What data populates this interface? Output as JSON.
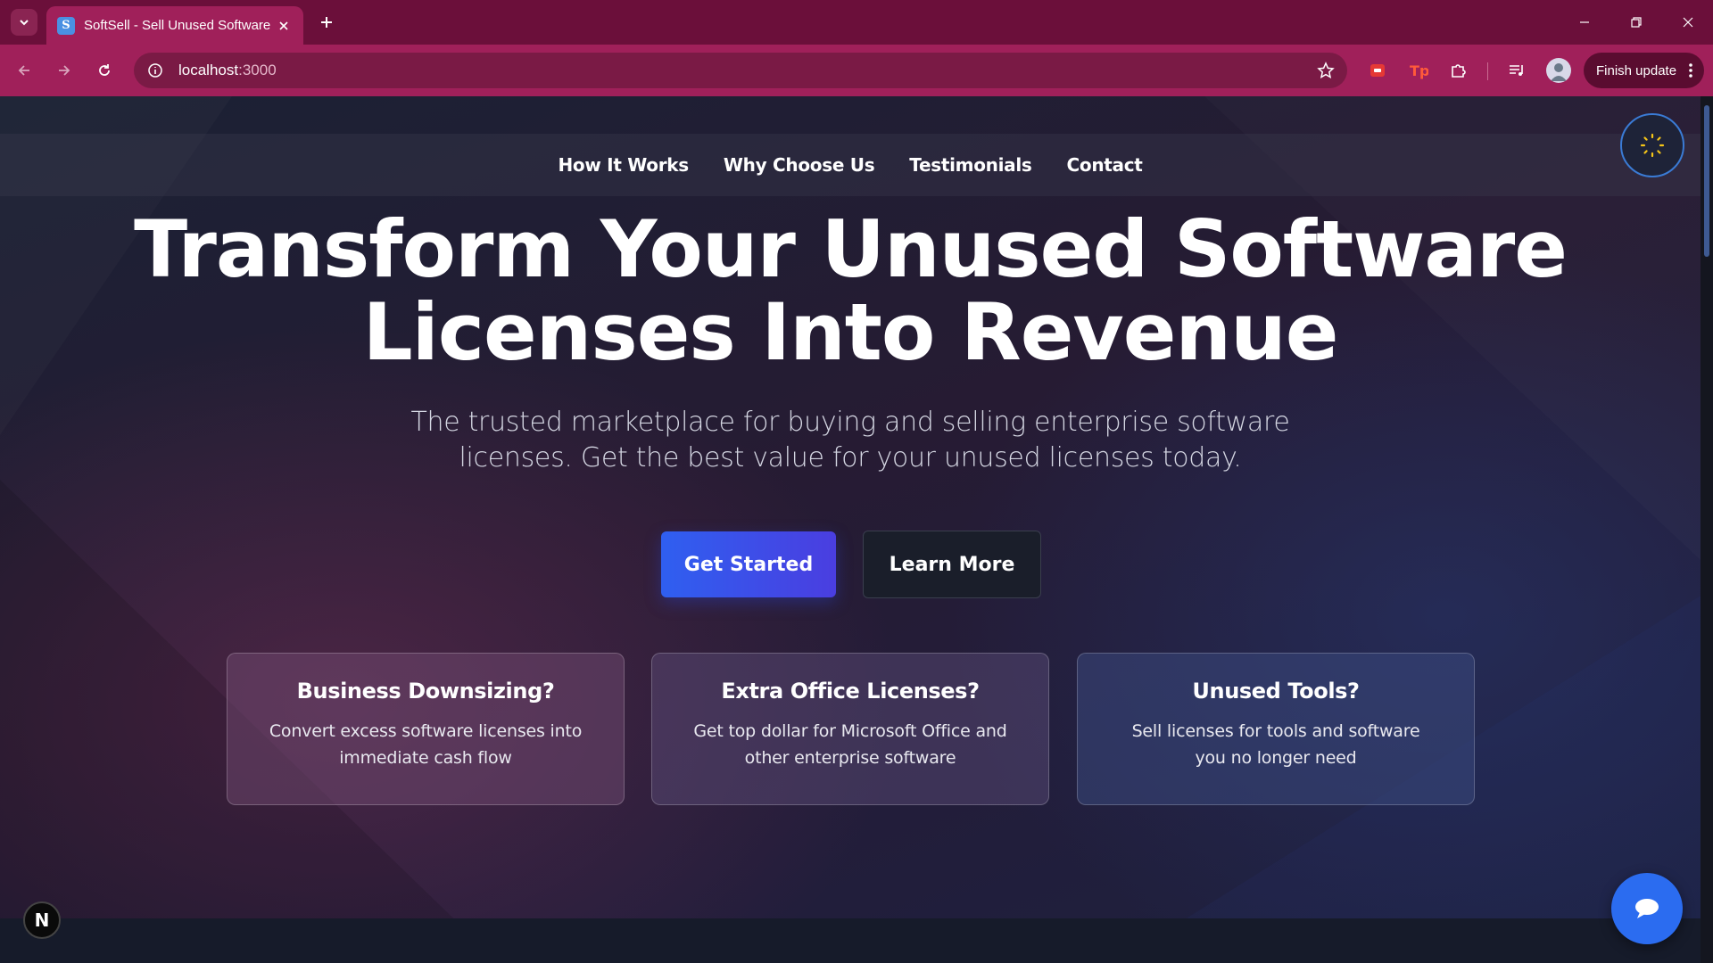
{
  "browser": {
    "tab_title": "SoftSell - Sell Unused Software",
    "favicon_letter": "S",
    "url_host": "localhost",
    "url_port": ":3000",
    "finish_update_label": "Finish update",
    "icons": [
      "tab-search-icon",
      "close-icon",
      "plus-icon",
      "minimize-icon",
      "restore-icon",
      "back-icon",
      "forward-icon",
      "reload-icon",
      "info-icon",
      "star-icon",
      "extensions-icon",
      "media-icon",
      "kebab-icon"
    ]
  },
  "nav": {
    "links": [
      "How It Works",
      "Why Choose Us",
      "Testimonials",
      "Contact"
    ]
  },
  "hero": {
    "title_line1": "Transform Your Unused Software",
    "title_line2": "Licenses Into Revenue",
    "subtitle_line1": "The trusted marketplace for buying and selling enterprise software",
    "subtitle_line2": "licenses. Get the best value for your unused licenses today.",
    "primary_button": "Get Started",
    "secondary_button": "Learn More"
  },
  "cards": [
    {
      "title": "Business Downsizing?",
      "text": "Convert excess software licenses into immediate cash flow"
    },
    {
      "title": "Extra Office Licenses?",
      "text": "Get top dollar for Microsoft Office and other enterprise software"
    },
    {
      "title": "Unused Tools?",
      "text": "Sell licenses for tools and software you no longer need"
    }
  ],
  "badges": {
    "nextjs_letter": "N"
  },
  "colors": {
    "browser_frame": "#a0205a",
    "tabstrip": "#6b0f3a",
    "primary_button": "#2f5ff0",
    "chat_button": "#2b6cf0",
    "theme_toggle_ring": "#3a7bd5"
  }
}
